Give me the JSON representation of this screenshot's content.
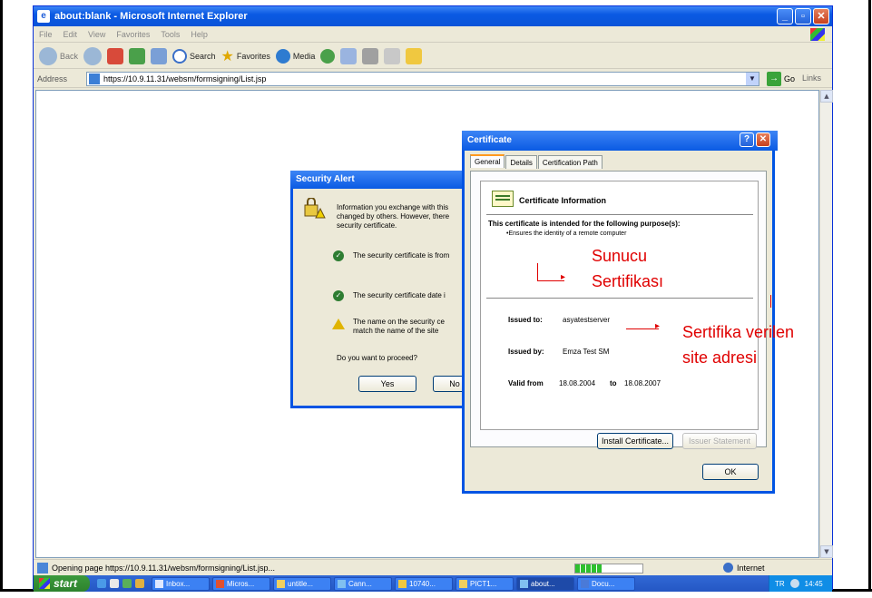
{
  "ie_window": {
    "title": "about:blank - Microsoft Internet Explorer",
    "menu": [
      "File",
      "Edit",
      "View",
      "Favorites",
      "Tools",
      "Help"
    ],
    "toolbar": {
      "back": "Back",
      "search": "Search",
      "favorites": "Favorites",
      "media": "Media"
    },
    "address_label": "Address",
    "address_value": "https://10.9.11.31/websm/formsigning/List.jsp",
    "go_label": "Go",
    "links_label": "Links",
    "status_text": "Opening page https://10.9.11.31/websm/formsigning/List.jsp...",
    "zone_label": "Internet"
  },
  "taskbar": {
    "start_label": "start",
    "buttons": [
      "Inbox...",
      "Micros...",
      "untitle...",
      "Cann...",
      "10740...",
      "PICT1...",
      "about...",
      "Docu..."
    ],
    "active_index": 6,
    "language": "TR",
    "clock": "14:45"
  },
  "security_alert": {
    "title": "Security Alert",
    "intro": [
      "Information you exchange with this",
      "changed by others. However, there",
      "security certificate."
    ],
    "item1": "The security certificate is from",
    "item2": "The security certificate date i",
    "item3": [
      "The name on the security ce",
      "match the name of the site"
    ],
    "question": "Do you want to proceed?",
    "yes_label": "Yes",
    "no_label": "No"
  },
  "certificate": {
    "title": "Certificate",
    "help_btn": "?",
    "tabs": [
      "General",
      "Details",
      "Certification Path"
    ],
    "heading": "Certificate Information",
    "purpose_heading": "This certificate is intended for the following purpose(s):",
    "purpose_item": "•Ensures the identity of a remote computer",
    "issued_to_label": "Issued to:",
    "issued_to_value": "asyatestserver",
    "issued_by_label": "Issued by:",
    "issued_by_value": "Emza Test SM",
    "valid_from_label": "Valid from",
    "valid_from": "18.08.2004",
    "valid_to_label": "to",
    "valid_to": "18.08.2007",
    "install_btn": "Install Certificate...",
    "issuer_btn": "Issuer Statement",
    "ok_btn": "OK"
  },
  "annotations": {
    "server_cert_line1": "Sunucu",
    "server_cert_line2": "Sertifikası",
    "site_line1": "Sertifika verilen",
    "site_line2": "site adresi"
  }
}
